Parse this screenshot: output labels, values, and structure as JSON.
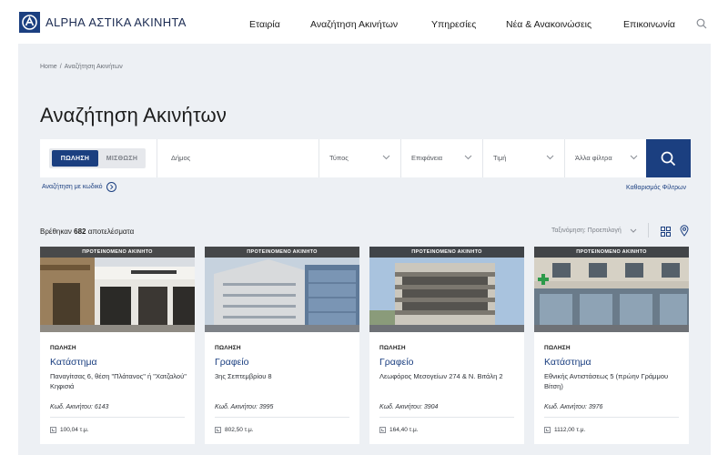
{
  "header": {
    "logo_text": "ALPHA ΑΣΤΙΚΑ ΑΚΙΝΗΤΑ",
    "nav": [
      "Εταιρία",
      "Αναζήτηση Ακινήτων",
      "Υπηρεσίες",
      "Νέα & Ανακοινώσεις",
      "Επικοινωνία"
    ],
    "search_icon": "search-icon"
  },
  "breadcrumb": [
    "Home",
    "Αναζήτηση Ακινήτων"
  ],
  "page_title": "Αναζήτηση Ακινήτων",
  "search": {
    "toggle": [
      "ΠΩΛΗΣΗ",
      "ΜΙΣΘΩΣΗ"
    ],
    "selected": "ΠΩΛΗΣΗ",
    "municipality_placeholder": "Δήμος",
    "type_label": "Τύπος",
    "area_label": "Επιφάνεια",
    "price_label": "Τιμή",
    "other_filters_label": "Άλλα φίλτρα"
  },
  "search_by_code": "Αναζήτηση με κωδικό",
  "clear_filters": "Καθαρισμός Φίλτρων",
  "results": {
    "prefix": "Βρέθηκαν",
    "count": "682",
    "suffix": "αποτελέσματα",
    "sort": "Ταξινόμηση: Προεπιλογή"
  },
  "colors": {
    "brand": "#1b3f80",
    "page_bg": "#edf0f4"
  },
  "cards": [
    {
      "badge": "ΠΡΟΤΕΙΝΟΜΕΝΟ ΑΚΙΝΗΤΟ",
      "type": "ΠΩΛΗΣΗ",
      "title": "Κατάστημα",
      "address": "Παναγίτσας 6, θέση \"Πλάτανος\" ή \"Χατζαλού\" Κηφισιά",
      "code": "Κωδ. Ακινήτου: 6143",
      "area": "100,04 τ.μ."
    },
    {
      "badge": "ΠΡΟΤΕΙΝΟΜΕΝΟ ΑΚΙΝΗΤΟ",
      "type": "ΠΩΛΗΣΗ",
      "title": "Γραφείο",
      "address": "3ης Σεπτεμβρίου 8",
      "code": "Κωδ. Ακινήτου: 3995",
      "area": "802,50 τ.μ."
    },
    {
      "badge": "ΠΡΟΤΕΙΝΟΜΕΝΟ ΑΚΙΝΗΤΟ",
      "type": "ΠΩΛΗΣΗ",
      "title": "Γραφείο",
      "address": "Λεωφόρος Μεσογείων 274 & Ν. Βιτάλη 2",
      "code": "Κωδ. Ακινήτου: 3904",
      "area": "164,40 τ.μ."
    },
    {
      "badge": "ΠΡΟΤΕΙΝΟΜΕΝΟ ΑΚΙΝΗΤΟ",
      "type": "ΠΩΛΗΣΗ",
      "title": "Κατάστημα",
      "address": "Εθνικής Αντιστάσεως 5 (πρώην Γράμμου Βίτση)",
      "code": "Κωδ. Ακινήτου: 3976",
      "area": "1112,00 τ.μ."
    }
  ]
}
